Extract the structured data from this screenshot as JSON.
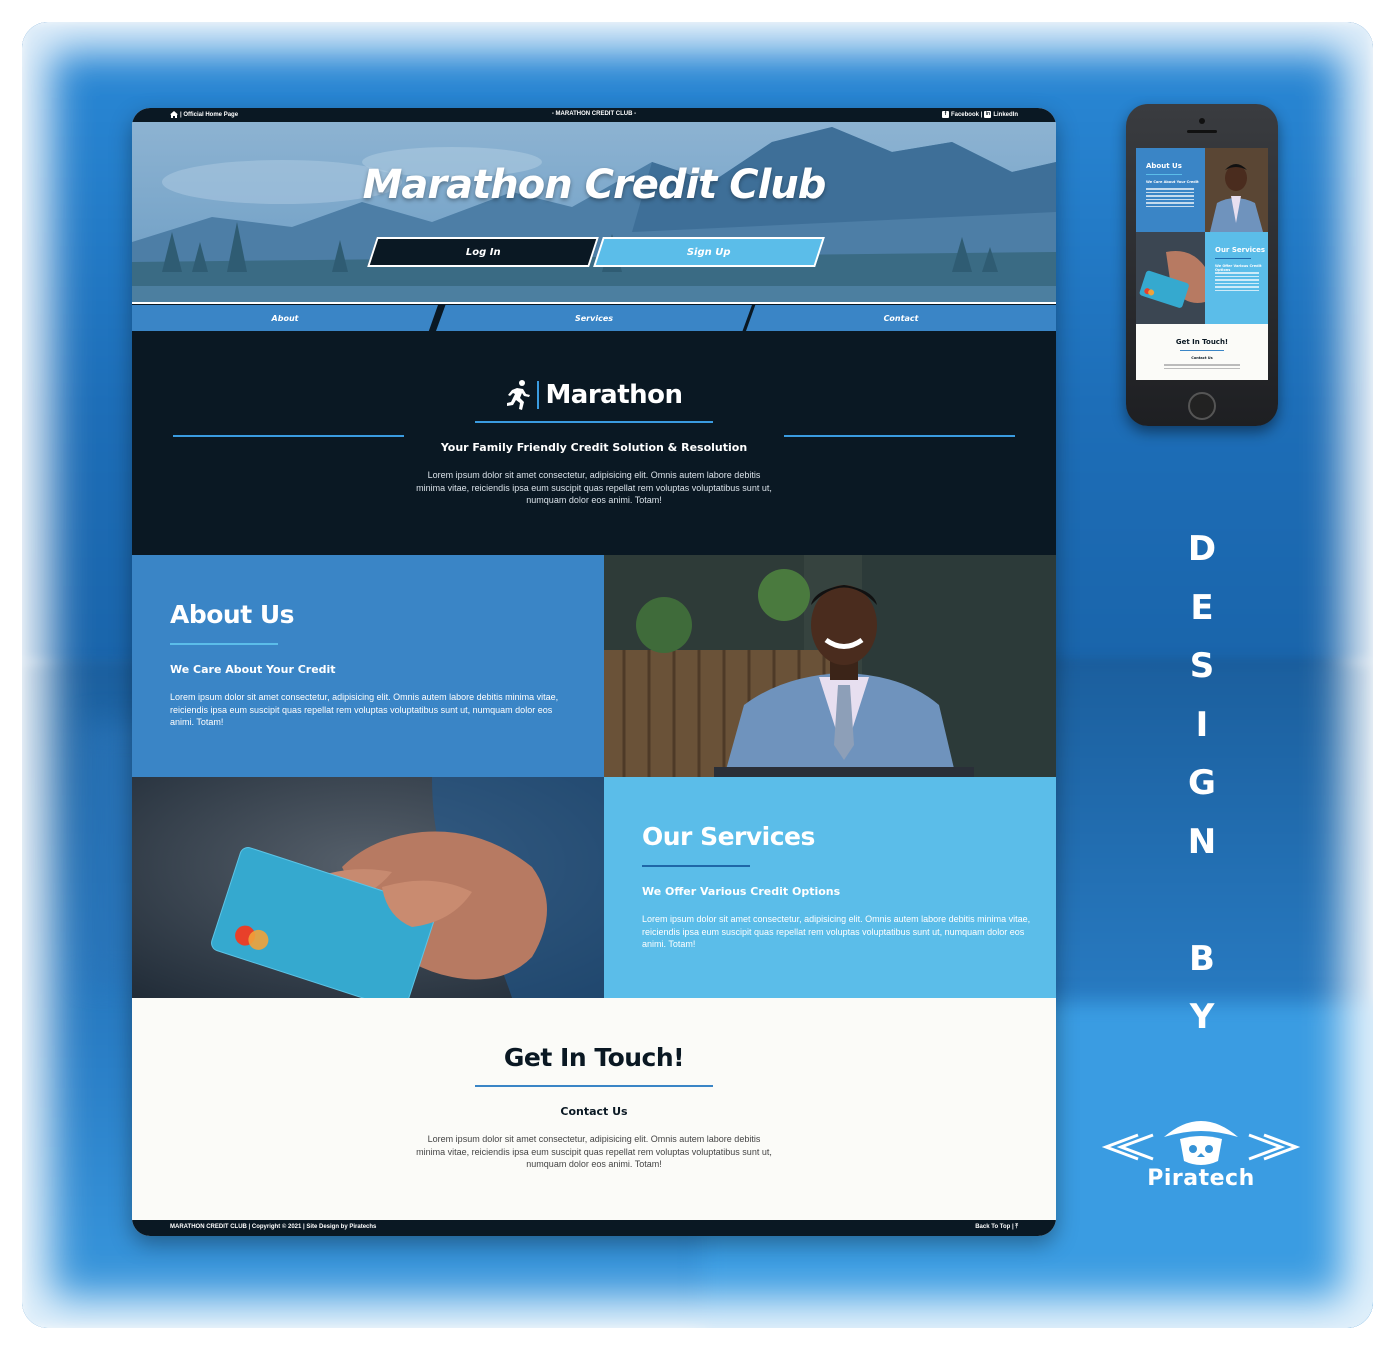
{
  "topbar": {
    "home_link": "| Official Home Page",
    "center": "- MARATHON CREDIT CLUB -",
    "facebook": "Facebook |",
    "linkedin": "LinkedIn"
  },
  "hero": {
    "title": "Marathon Credit Club",
    "login_label": "Log In",
    "signup_label": "Sign Up"
  },
  "nav": {
    "items": [
      "About",
      "Services",
      "Contact"
    ]
  },
  "intro": {
    "brand": "Marathon",
    "subtitle": "Your Family Friendly Credit Solution & Resolution",
    "paragraph": "Lorem ipsum dolor sit amet consectetur, adipisicing elit. Omnis autem labore debitis minima vitae, reiciendis ipsa eum suscipit quas repellat rem voluptas voluptatibus sunt ut, numquam dolor eos animi. Totam!"
  },
  "about": {
    "title": "About Us",
    "subtitle": "We Care About Your Credit",
    "paragraph": "Lorem ipsum dolor sit amet consectetur, adipisicing elit. Omnis autem labore debitis minima vitae, reiciendis ipsa eum suscipit quas repellat rem voluptas voluptatibus sunt ut, numquam dolor eos animi. Totam!"
  },
  "services": {
    "title": "Our Services",
    "subtitle": "We Offer Various Credit Options",
    "paragraph": "Lorem ipsum dolor sit amet consectetur, adipisicing elit. Omnis autem labore debitis minima vitae, reiciendis ipsa eum suscipit quas repellat rem voluptas voluptatibus sunt ut, numquam dolor eos animi. Totam!"
  },
  "contact": {
    "title": "Get In Touch!",
    "subtitle": "Contact Us",
    "paragraph": "Lorem ipsum dolor sit amet consectetur, adipisicing elit. Omnis autem labore debitis minima vitae, reiciendis ipsa eum suscipit quas repellat rem voluptas voluptatibus sunt ut, numquam dolor eos animi. Totam!"
  },
  "footer": {
    "left": "MARATHON CREDIT CLUB | Copyright © 2021 | Site Design by Piratechs",
    "right": "Back To Top | ⤒"
  },
  "phone": {
    "about_title": "About Us",
    "about_sub": "We Care About Your Credit",
    "services_title": "Our Services",
    "services_sub": "We Offer Various Credit Options",
    "contact_title": "Get In Touch!",
    "contact_sub": "Contact Us"
  },
  "designby": {
    "letters": [
      "D",
      "E",
      "S",
      "I",
      "G",
      "N",
      "",
      "B",
      "Y"
    ],
    "brand": "Piratech"
  },
  "colors": {
    "navy": "#0a1823",
    "blue": "#3a85c6",
    "light_blue": "#5bbde9",
    "offwhite": "#fbfbf8"
  },
  "icons": {
    "home": "home-icon",
    "facebook": "facebook-icon",
    "linkedin": "linkedin-icon",
    "runner": "runner-icon",
    "back_to_top": "arrow-up-icon"
  }
}
